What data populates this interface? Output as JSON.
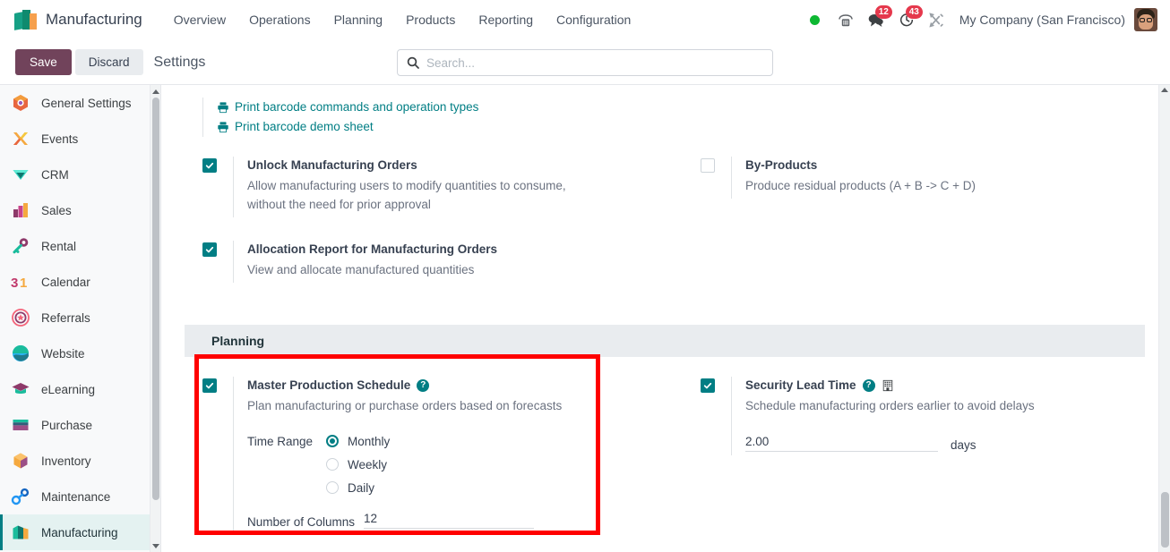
{
  "topbar": {
    "brand": "Manufacturing",
    "brand_logo_icon": "manufacturing-app-icon",
    "nav": [
      {
        "label": "Overview",
        "name": "overview"
      },
      {
        "label": "Operations",
        "name": "operations"
      },
      {
        "label": "Planning",
        "name": "planning"
      },
      {
        "label": "Products",
        "name": "products"
      },
      {
        "label": "Reporting",
        "name": "reporting"
      },
      {
        "label": "Configuration",
        "name": "configuration"
      }
    ],
    "status_dot_icon": "online-status-dot",
    "phone_icon": "phone-dialpad-icon",
    "messages_icon": "chat-bubble-icon",
    "messages_count": "12",
    "activities_icon": "clock-activities-icon",
    "activities_count": "43",
    "tools_icon": "tools-wrench-icon",
    "company": "My Company (San Francisco)",
    "avatar_icon": "user-avatar"
  },
  "controlbar": {
    "save_label": "Save",
    "discard_label": "Discard",
    "breadcrumb": "Settings"
  },
  "search": {
    "placeholder": "Search...",
    "value": "",
    "icon": "search-icon"
  },
  "sidebar": {
    "items": [
      {
        "label": "General Settings",
        "name": "general-settings",
        "active": false
      },
      {
        "label": "Events",
        "name": "events",
        "active": false
      },
      {
        "label": "CRM",
        "name": "crm",
        "active": false
      },
      {
        "label": "Sales",
        "name": "sales",
        "active": false
      },
      {
        "label": "Rental",
        "name": "rental",
        "active": false
      },
      {
        "label": "Calendar",
        "name": "calendar",
        "active": false
      },
      {
        "label": "Referrals",
        "name": "referrals",
        "active": false
      },
      {
        "label": "Website",
        "name": "website",
        "active": false
      },
      {
        "label": "eLearning",
        "name": "elearning",
        "active": false
      },
      {
        "label": "Purchase",
        "name": "purchase",
        "active": false
      },
      {
        "label": "Inventory",
        "name": "inventory",
        "active": false
      },
      {
        "label": "Maintenance",
        "name": "maintenance",
        "active": false
      },
      {
        "label": "Manufacturing",
        "name": "manufacturing",
        "active": true
      }
    ]
  },
  "settings": {
    "barcode_links": [
      {
        "label": "Print barcode commands and operation types",
        "icon": "printer-icon"
      },
      {
        "label": "Print barcode demo sheet",
        "icon": "printer-icon"
      }
    ],
    "unlock_mo": {
      "title": "Unlock Manufacturing Orders",
      "desc": "Allow manufacturing users to modify quantities to consume, without the need for prior approval",
      "checked": true
    },
    "by_products": {
      "title": "By-Products",
      "desc": "Produce residual products (A + B -> C + D)",
      "checked": false
    },
    "allocation_report": {
      "title": "Allocation Report for Manufacturing Orders",
      "desc": "View and allocate manufactured quantities",
      "checked": true
    },
    "planning_section": "Planning",
    "mps": {
      "title": "Master Production Schedule",
      "desc": "Plan manufacturing or purchase orders based on forecasts",
      "checked": true,
      "help_icon": "help-question-icon",
      "time_range_label": "Time Range",
      "options": [
        {
          "label": "Monthly",
          "selected": true
        },
        {
          "label": "Weekly",
          "selected": false
        },
        {
          "label": "Daily",
          "selected": false
        }
      ],
      "columns_label": "Number of Columns",
      "columns_value": "12"
    },
    "security_lead_time": {
      "title": "Security Lead Time",
      "desc": "Schedule manufacturing orders earlier to avoid delays",
      "checked": true,
      "help_icon": "help-question-icon",
      "company_icon": "company-building-icon",
      "value": "2.00",
      "unit": "days"
    }
  },
  "annotation": {
    "highlight_color": "#ff0000",
    "target": "master-production-schedule-setting"
  },
  "colors": {
    "accent_teal": "#017e84",
    "save_purple": "#71435b",
    "badge_red": "#e5384c",
    "band_gray": "#e9ecef"
  }
}
